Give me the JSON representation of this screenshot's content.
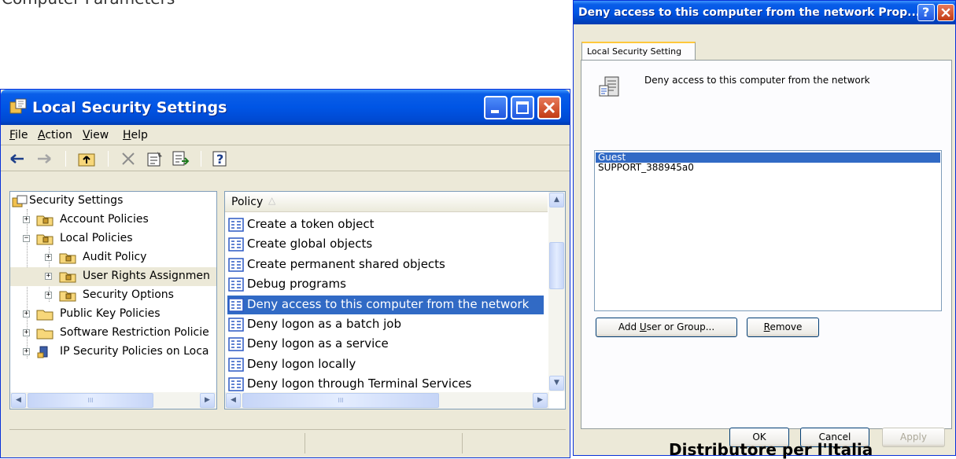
{
  "background": {
    "top_text": "Computer Parameters",
    "bottom_text": "Distributore per l'Italia"
  },
  "main_window": {
    "title": "Local Security Settings",
    "menu": [
      "File",
      "Action",
      "View",
      "Help"
    ],
    "menu_accel": [
      "F",
      "A",
      "V",
      "H"
    ],
    "tree": {
      "root": "Security Settings",
      "items": [
        {
          "label": "Account Policies",
          "expander": "+"
        },
        {
          "label": "Local Policies",
          "expander": "−"
        },
        {
          "label": "Audit Policy",
          "expander": "+"
        },
        {
          "label": "User Rights Assignmen",
          "expander": "+"
        },
        {
          "label": "Security Options",
          "expander": "+"
        },
        {
          "label": "Public Key Policies",
          "expander": "+"
        },
        {
          "label": "Software Restriction Policie",
          "expander": "+"
        },
        {
          "label": "IP Security Policies on Loca",
          "expander": "+"
        }
      ]
    },
    "list": {
      "column_header": "Policy",
      "sort_glyph": "△",
      "rows": [
        "Create a token object",
        "Create global objects",
        "Create permanent shared objects",
        "Debug programs",
        "Deny access to this computer from the network",
        "Deny logon as a batch job",
        "Deny logon as a service",
        "Deny logon locally",
        "Deny logon through Terminal Services"
      ],
      "selected_index": 4
    },
    "scroll_glyphs": {
      "up": "▲",
      "down": "▼",
      "left": "◀",
      "right": "▶",
      "grip": "III"
    }
  },
  "dialog": {
    "title": "Deny access to this computer from the network Prop...",
    "help_glyph": "?",
    "tab_label": "Local Security Setting",
    "policy_name": "Deny access to this computer from the network",
    "users": [
      "Guest",
      "SUPPORT_388945a0"
    ],
    "selected_user_index": 0,
    "add_button": {
      "pre": "Add ",
      "accel": "U",
      "post": "ser or Group..."
    },
    "remove_button": {
      "pre": "",
      "accel": "R",
      "post": "emove"
    },
    "ok_label": "OK",
    "cancel_label": "Cancel",
    "apply_label": "Apply"
  },
  "colors": {
    "selection": "#316ac5",
    "titlebar": "#0055e5",
    "window_bg": "#ece9d8"
  }
}
